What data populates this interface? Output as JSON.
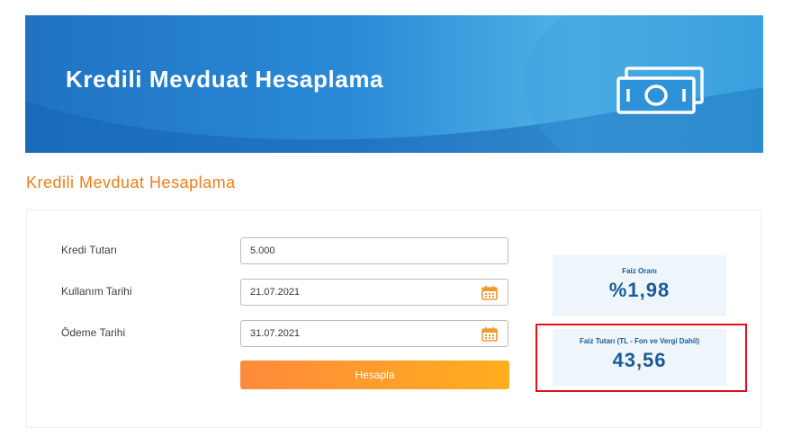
{
  "banner": {
    "title": "Kredili Mevduat Hesaplama",
    "icon": "banknote-icon"
  },
  "section": {
    "title": "Kredili Mevduat Hesaplama"
  },
  "form": {
    "amount_label": "Kredi Tutarı",
    "amount_value": "5.000",
    "usage_date_label": "Kullanım Tarihi",
    "usage_date_value": "21.07.2021",
    "payment_date_label": "Ödeme Tarihi",
    "payment_date_value": "31.07.2021",
    "calendar_icon": "calendar-icon",
    "submit_label": "Hesapla"
  },
  "results": {
    "rate_label": "Faiz Oranı",
    "rate_value": "%1,98",
    "interest_label": "Faiz Tutarı (TL - Fon ve Vergi Dahil)",
    "interest_value": "43,56"
  },
  "colors": {
    "banner_blue": "#2b8bd7",
    "accent_orange": "#f07c1a",
    "button_start": "#ff8a3c",
    "button_end": "#ffae1e",
    "result_text": "#1b5b94",
    "result_bg": "#eef6fb",
    "highlight_red": "#e0101a"
  }
}
